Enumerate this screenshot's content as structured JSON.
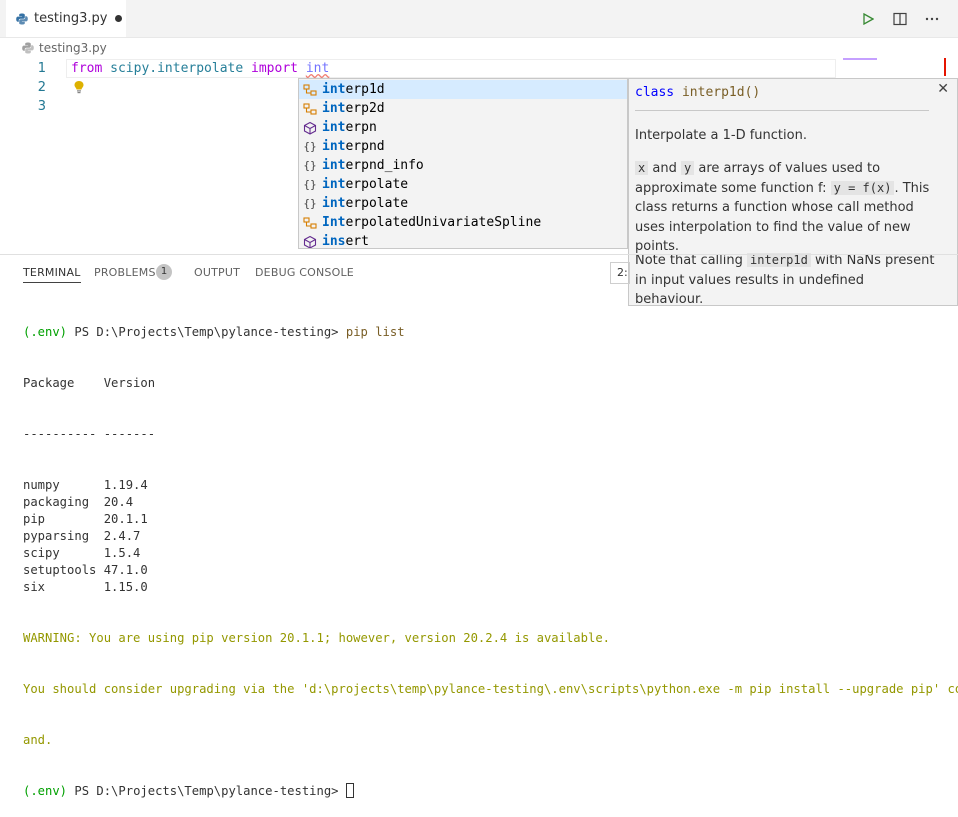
{
  "tab": {
    "title": "testing3.py"
  },
  "breadcrumb": {
    "file": "testing3.py"
  },
  "editor": {
    "lines": [
      {
        "num": "1",
        "kw_from": "from",
        "module": "scipy.interpolate",
        "kw_import": "import",
        "typed": "int"
      },
      {
        "num": "2"
      },
      {
        "num": "3"
      }
    ]
  },
  "suggestions": [
    {
      "match": "int",
      "rest": "erp1d",
      "icon": "class-icon",
      "selected": true
    },
    {
      "match": "int",
      "rest": "erp2d",
      "icon": "class-icon"
    },
    {
      "match": "int",
      "rest": "erpn",
      "icon": "function-icon"
    },
    {
      "match": "int",
      "rest": "erpnd",
      "icon": "module-icon"
    },
    {
      "match": "int",
      "rest": "erpnd_info",
      "icon": "module-icon"
    },
    {
      "match": "int",
      "rest": "erpolate",
      "icon": "module-icon"
    },
    {
      "match": "int",
      "rest": "erpolate",
      "icon": "module-icon"
    },
    {
      "match": "Int",
      "rest": "erpolatedUnivariateSpline",
      "icon": "class-icon"
    },
    {
      "match": "ins",
      "rest": "ert",
      "icon": "function-icon"
    }
  ],
  "details": {
    "sig_kw": "class",
    "sig_name": "interp1d()",
    "p1": "Interpolate a 1-D function.",
    "p2_x": "x",
    "p2_and": "and",
    "p2_y": "y",
    "p2_a": "are arrays of values used to approximate some function f:",
    "p2_code": "y = f(x)",
    "p2_b": ". This class returns a function whose call method uses interpolation to find the value of new points.",
    "p3_a": "Note that calling",
    "p3_code": "interp1d",
    "p3_b": "with NaNs present in input values results in undefined behaviour."
  },
  "panel": {
    "tabs": [
      "TERMINAL",
      "PROBLEMS",
      "OUTPUT",
      "DEBUG CONSOLE"
    ],
    "problems_count": "1",
    "terminal_select": "2:"
  },
  "terminal": {
    "prompt1_env": "(.env)",
    "prompt1_path": " PS D:\\Projects\\Temp\\pylance-testing> ",
    "prompt1_cmd": "pip list",
    "header": "Package    Version",
    "sep": "---------- -------",
    "packages": [
      "numpy      1.19.4",
      "packaging  20.4",
      "pip        20.1.1",
      "pyparsing  2.4.7",
      "scipy      1.5.4",
      "setuptools 47.1.0",
      "six        1.15.0"
    ],
    "warn1": "WARNING: You are using pip version 20.1.1; however, version 20.2.4 is available.",
    "warn2": "You should consider upgrading via the 'd:\\projects\\temp\\pylance-testing\\.env\\scripts\\python.exe -m pip install --upgrade pip' comm",
    "warn3": "and.",
    "prompt2_env": "(.env)",
    "prompt2_path": " PS D:\\Projects\\Temp\\pylance-testing> "
  }
}
